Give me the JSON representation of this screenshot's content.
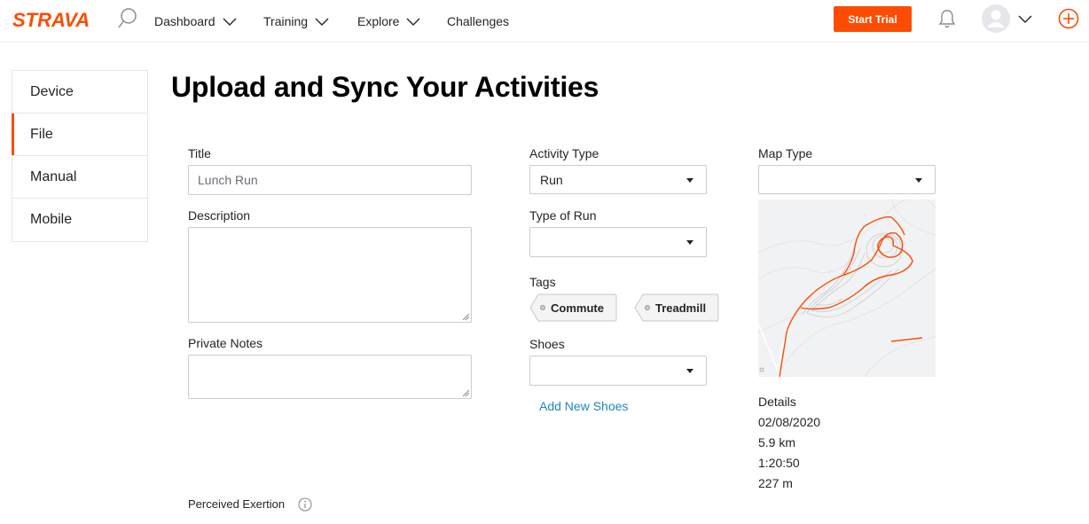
{
  "brand": {
    "logo_text": "STRAVA",
    "accent": "#fc4c02"
  },
  "nav": {
    "items": [
      {
        "label": "Dashboard"
      },
      {
        "label": "Training"
      },
      {
        "label": "Explore"
      },
      {
        "label": "Challenges"
      }
    ],
    "trial_label": "Start Trial"
  },
  "sidebar": {
    "items": [
      {
        "label": "Device"
      },
      {
        "label": "File",
        "active": true
      },
      {
        "label": "Manual"
      },
      {
        "label": "Mobile"
      }
    ]
  },
  "page_title": "Upload and Sync Your Activities",
  "form": {
    "title_label": "Title",
    "title_value": "Lunch Run",
    "description_label": "Description",
    "private_notes_label": "Private Notes",
    "perceived_exertion_label": "Perceived Exertion",
    "activity_type_label": "Activity Type",
    "activity_type_value": "Run",
    "type_of_run_label": "Type of Run",
    "type_of_run_value": "",
    "tags_label": "Tags",
    "tags": [
      {
        "label": "Commute"
      },
      {
        "label": "Treadmill"
      }
    ],
    "shoes_label": "Shoes",
    "shoes_value": "",
    "add_shoes_label": "Add New Shoes",
    "map_type_label": "Map Type",
    "map_type_value": ""
  },
  "details": {
    "label": "Details",
    "date": "02/08/2020",
    "distance": "5.9 km",
    "time": "1:20:50",
    "elevation": "227 m"
  }
}
